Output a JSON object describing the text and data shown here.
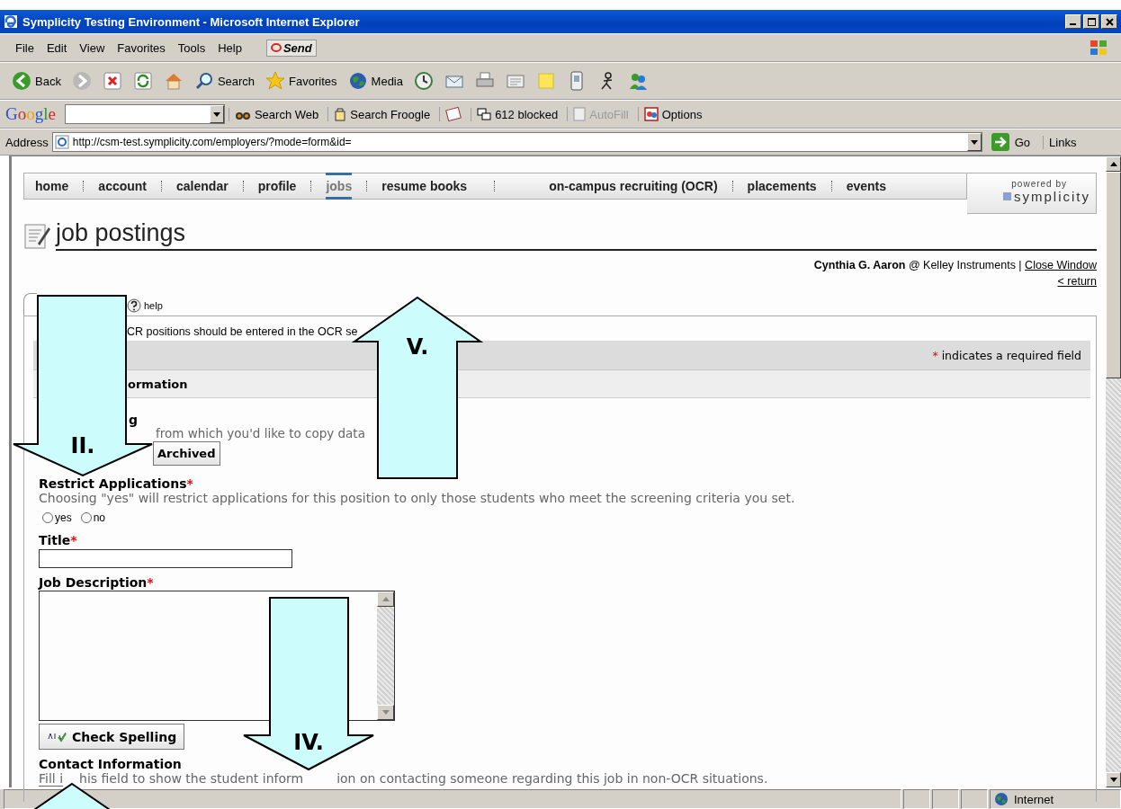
{
  "window": {
    "title": "Symplicity Testing Environment - Microsoft Internet Explorer"
  },
  "menu": [
    "File",
    "Edit",
    "View",
    "Favorites",
    "Tools",
    "Help"
  ],
  "send_button": "Send",
  "toolbar": [
    {
      "kind": "back",
      "label": "Back"
    },
    {
      "kind": "forward"
    },
    {
      "kind": "stop"
    },
    {
      "kind": "refresh"
    },
    {
      "kind": "home"
    },
    {
      "kind": "search",
      "label": "Search"
    },
    {
      "kind": "favorites",
      "label": "Favorites"
    },
    {
      "kind": "media",
      "label": "Media"
    },
    {
      "kind": "history"
    },
    {
      "kind": "mail"
    },
    {
      "kind": "print"
    },
    {
      "kind": "edit"
    },
    {
      "kind": "note"
    },
    {
      "kind": "phone"
    },
    {
      "kind": "messenger"
    },
    {
      "kind": "people"
    }
  ],
  "google_bar": {
    "logo": "Google",
    "search_web": "Search Web",
    "search_froogle": "Search Froogle",
    "blocked": "612 blocked",
    "autofill": {
      "label": "AutoFill",
      "disabled": true
    },
    "options": "Options"
  },
  "address_bar": {
    "label": "Address",
    "url": "http://csm-test.symplicity.com/employers/?mode=form&id=",
    "go": "Go",
    "links": "Links"
  },
  "nav": [
    {
      "label": "home",
      "selected": false
    },
    {
      "label": "account",
      "selected": false
    },
    {
      "label": "calendar",
      "selected": false
    },
    {
      "label": "profile",
      "selected": false
    },
    {
      "label": "jobs",
      "selected": true
    },
    {
      "label": "resume books",
      "selected": false
    },
    {
      "label": "on-campus recruiting (OCR)",
      "selected": false
    },
    {
      "label": "placements",
      "selected": false
    },
    {
      "label": "events",
      "selected": false
    }
  ],
  "powered_by": {
    "caption": "powered by",
    "brand": "symplicity"
  },
  "heading": "job postings",
  "user_line": "**Cynthia G. Aaron** @ Kelley Instruments |",
  "close_link": "Close Window",
  "return_link": "< return",
  "help_link": "help",
  "note_fragment": "CR positions should be entered in the OCR se",
  "required_mark": "*",
  "required_note": "indicates a required field",
  "section_fragment": "ormation",
  "copy": {
    "label_fragment": "g",
    "description_fragment": "from which you'd like to copy data",
    "button_fragment": "Archived"
  },
  "restrict": {
    "label": "Restrict Applications",
    "required": true,
    "description": "Choosing \"yes\" will restrict applications for this position to only those students who meet the screening criteria you set.",
    "options": [
      {
        "label": "yes",
        "selected": false
      },
      {
        "label": "no",
        "selected": false
      }
    ]
  },
  "title_field": {
    "label": "Title",
    "required": true
  },
  "description_field": {
    "label": "Job Description",
    "required": true
  },
  "spell_button": "Check Spelling",
  "contact": {
    "label": "Contact Information",
    "description_fragments": [
      "Fill i",
      "his field to show the student inform",
      "ion on contacting someone regarding this job in non-OCR situations."
    ]
  },
  "status_bar": {
    "zone": "Internet"
  },
  "annotations": [
    {
      "label": "II.",
      "kind": "down"
    },
    {
      "label": "V.",
      "kind": "up"
    },
    {
      "label": "IV.",
      "kind": "down"
    },
    {
      "kind": "up"
    }
  ]
}
